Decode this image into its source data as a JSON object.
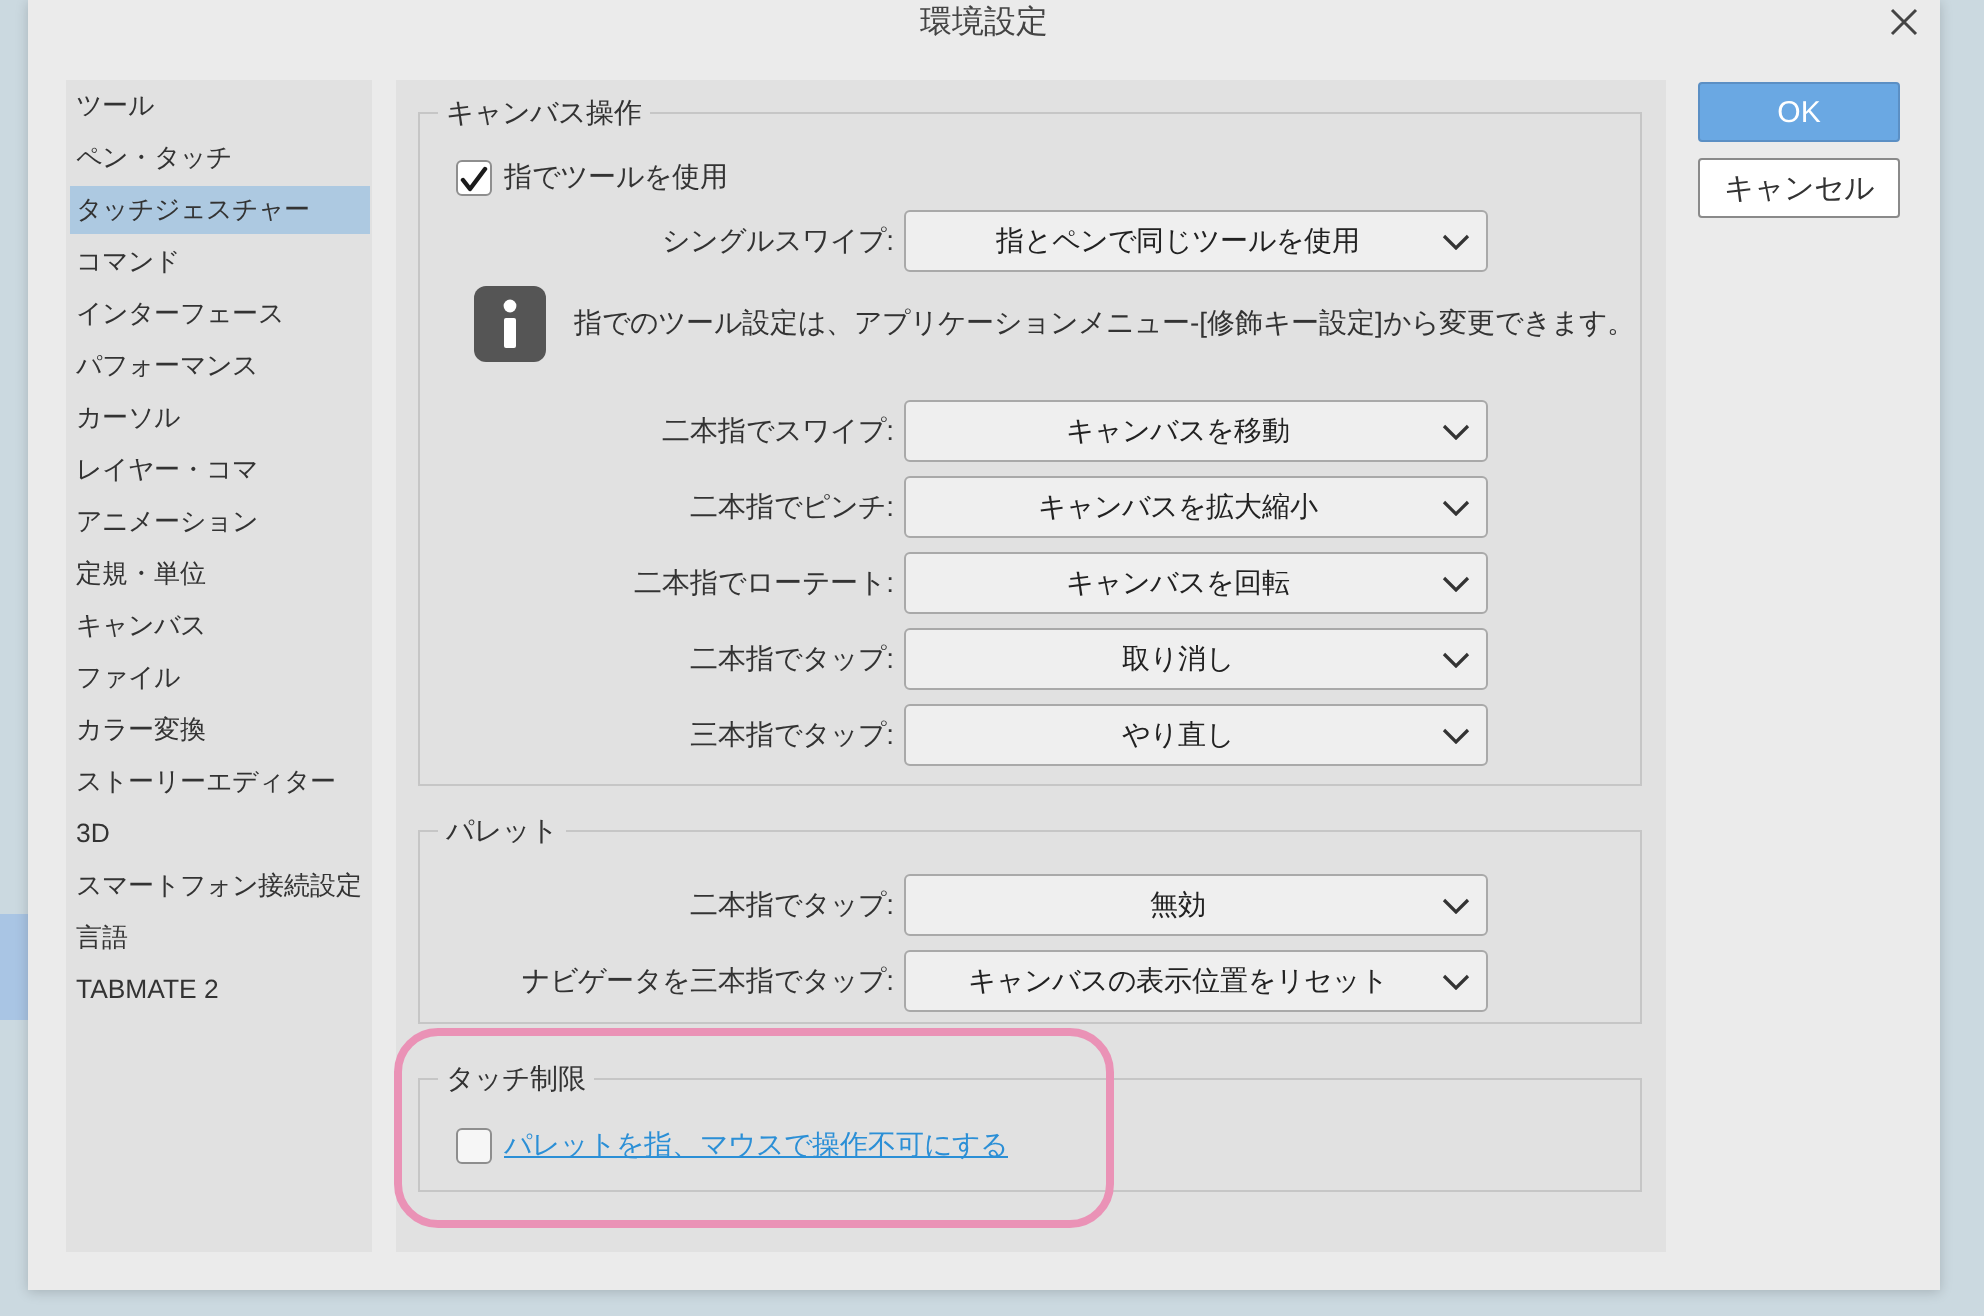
{
  "window": {
    "title": "環境設定"
  },
  "sidebar": {
    "items": [
      {
        "label": "ツール",
        "selected": false
      },
      {
        "label": "ペン・タッチ",
        "selected": false
      },
      {
        "label": "タッチジェスチャー",
        "selected": true
      },
      {
        "label": "コマンド",
        "selected": false
      },
      {
        "label": "インターフェース",
        "selected": false
      },
      {
        "label": "パフォーマンス",
        "selected": false
      },
      {
        "label": "カーソル",
        "selected": false
      },
      {
        "label": "レイヤー・コマ",
        "selected": false
      },
      {
        "label": "アニメーション",
        "selected": false
      },
      {
        "label": "定規・単位",
        "selected": false
      },
      {
        "label": "キャンバス",
        "selected": false
      },
      {
        "label": "ファイル",
        "selected": false
      },
      {
        "label": "カラー変換",
        "selected": false
      },
      {
        "label": "ストーリーエディター",
        "selected": false
      },
      {
        "label": "3D",
        "selected": false
      },
      {
        "label": "スマートフォン接続設定",
        "selected": false
      },
      {
        "label": "言語",
        "selected": false
      },
      {
        "label": "TABMATE 2",
        "selected": false
      }
    ]
  },
  "groups": [
    {
      "title": "キャンバス操作",
      "highlighted": false,
      "items": [
        {
          "kind": "checkbox",
          "label": "指でツールを使用",
          "checked": true,
          "link": false
        },
        {
          "kind": "dropdown",
          "label": "シングルスワイプ:",
          "value": "指とペンで同じツールを使用"
        },
        {
          "kind": "info",
          "text": "指でのツール設定は、アプリケーションメニュー-[修飾キー設定]から変更できます。"
        },
        {
          "kind": "dropdown",
          "label": "二本指でスワイプ:",
          "value": "キャンバスを移動"
        },
        {
          "kind": "dropdown",
          "label": "二本指でピンチ:",
          "value": "キャンバスを拡大縮小"
        },
        {
          "kind": "dropdown",
          "label": "二本指でローテート:",
          "value": "キャンバスを回転"
        },
        {
          "kind": "dropdown",
          "label": "二本指でタップ:",
          "value": "取り消し"
        },
        {
          "kind": "dropdown",
          "label": "三本指でタップ:",
          "value": "やり直し"
        }
      ]
    },
    {
      "title": "パレット",
      "highlighted": false,
      "items": [
        {
          "kind": "dropdown",
          "label": "二本指でタップ:",
          "value": "無効"
        },
        {
          "kind": "dropdown",
          "label": "ナビゲータを三本指でタップ:",
          "value": "キャンバスの表示位置をリセット"
        }
      ]
    },
    {
      "title": "タッチ制限",
      "highlighted": true,
      "items": [
        {
          "kind": "checkbox",
          "label": "パレットを指、マウスで操作不可にする",
          "checked": false,
          "link": true
        }
      ]
    }
  ],
  "buttons": [
    {
      "label": "OK",
      "kind": "primary"
    },
    {
      "label": "キャンセル",
      "kind": "secondary"
    }
  ]
}
